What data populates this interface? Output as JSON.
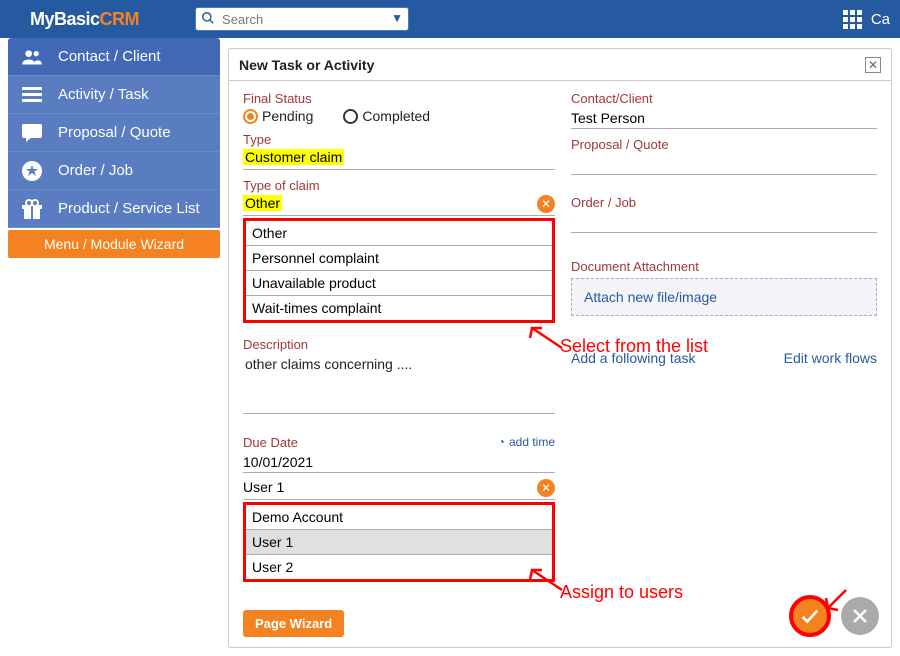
{
  "brand": {
    "prefix": "MyBasic",
    "suffix": "CRM"
  },
  "search": {
    "placeholder": "Search"
  },
  "topright_label": "Ca",
  "sidebar": {
    "items": [
      {
        "label": "Contact / Client"
      },
      {
        "label": "Activity / Task"
      },
      {
        "label": "Proposal / Quote"
      },
      {
        "label": "Order / Job"
      },
      {
        "label": "Product / Service List"
      }
    ],
    "wizard": "Menu / Module Wizard"
  },
  "panel": {
    "title": "New Task or Activity",
    "final_status_label": "Final Status",
    "pending_label": "Pending",
    "completed_label": "Completed",
    "type_label": "Type",
    "type_value": "Customer claim",
    "type_of_claim_label": "Type of claim",
    "type_of_claim_value": "Other",
    "claim_options": [
      "Other",
      "Personnel complaint",
      "Unavailable product",
      "Wait-times complaint"
    ],
    "description_label": "Description",
    "description_value": "other claims concerning ....",
    "due_date_label": "Due Date",
    "due_date_value": "10/01/2021",
    "add_time_label": "add time",
    "assignee_value": "User 1",
    "user_options": [
      "Demo Account",
      "User 1",
      "User 2"
    ],
    "contact_client_label": "Contact/Client",
    "contact_client_value": "Test Person",
    "proposal_quote_label": "Proposal / Quote",
    "order_job_label": "Order / Job",
    "document_attachment_label": "Document Attachment",
    "attach_text": "Attach new file/image",
    "following_task_label": "Add a following task",
    "edit_workflows_label": "Edit work flows",
    "page_wizard": "Page Wizard"
  },
  "annotations": {
    "select_list": "Select from the list",
    "assign_users": "Assign to users"
  }
}
